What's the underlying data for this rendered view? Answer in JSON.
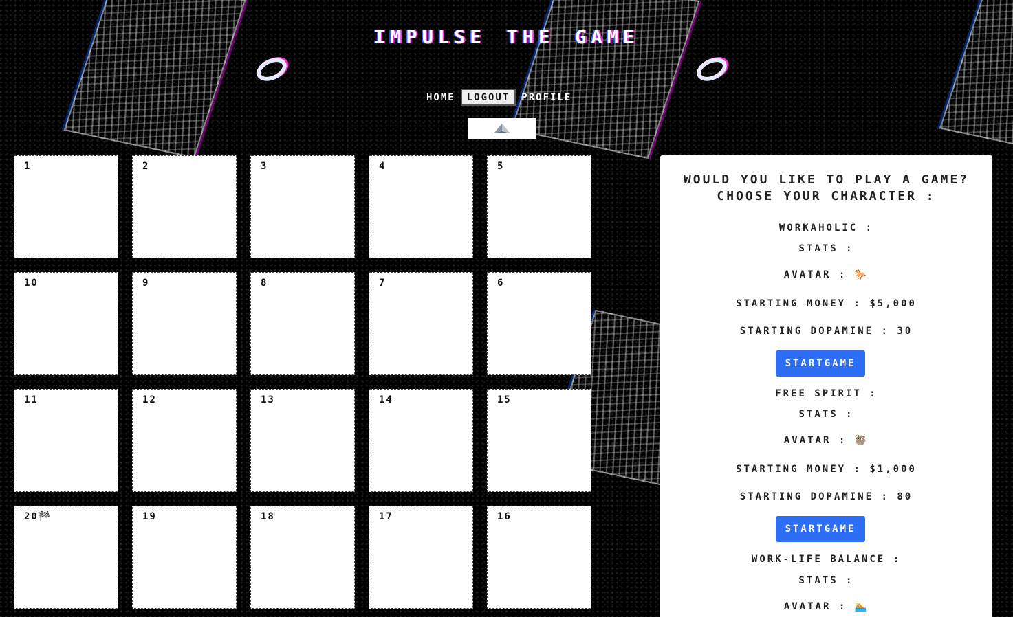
{
  "header": {
    "title": "IMPULSE THE GAME"
  },
  "nav": {
    "home": "HOME",
    "logout": "LOGOUT",
    "profile": "PROFILE"
  },
  "center_icon": "pyramid-icon",
  "board": {
    "rows": [
      [
        "1",
        "2",
        "3",
        "4",
        "5"
      ],
      [
        "10",
        "9",
        "8",
        "7",
        "6"
      ],
      [
        "11",
        "12",
        "13",
        "14",
        "15"
      ],
      [
        "20🏁",
        "19",
        "18",
        "17",
        "16"
      ]
    ]
  },
  "panel": {
    "question": "WOULD YOU LIKE TO PLAY A GAME?",
    "subtitle": "CHOOSE YOUR CHARACTER :",
    "stats_label": "STATS :",
    "avatar_label": "AVATAR :",
    "button_label": "STARTGAME",
    "characters": [
      {
        "name": "WORKAHOLIC :",
        "avatar": "🐎",
        "money": "STARTING MONEY : $5,000",
        "dopamine": "STARTING DOPAMINE : 30"
      },
      {
        "name": "FREE SPIRIT :",
        "avatar": "🦥",
        "money": "STARTING MONEY : $1,000",
        "dopamine": "STARTING DOPAMINE : 80"
      },
      {
        "name": "WORK-LIFE BALANCE :",
        "avatar": "🏊"
      }
    ]
  },
  "colors": {
    "button": "#2d6ef5",
    "panel": "#ffffff",
    "background": "#000000"
  }
}
